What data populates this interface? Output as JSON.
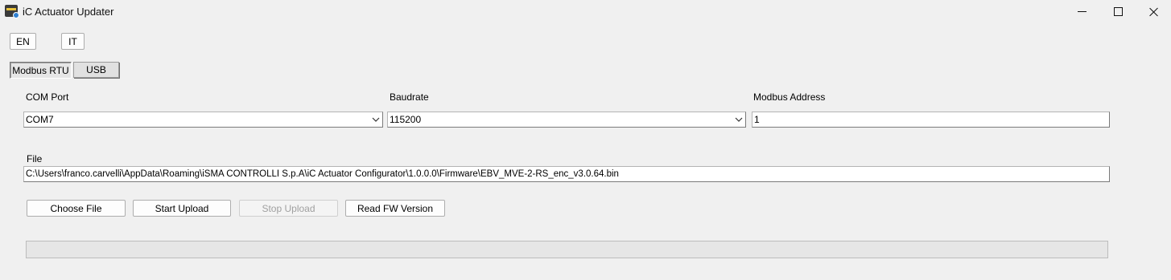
{
  "window": {
    "title": "iC Actuator Updater",
    "icon": "actuator-app-icon",
    "controls": [
      "minimize-icon",
      "maximize-icon",
      "close-icon"
    ]
  },
  "language": {
    "en_label": "EN",
    "it_label": "IT"
  },
  "tabs": [
    {
      "label": "Modbus RTU",
      "active": true
    },
    {
      "label": "USB",
      "active": false
    }
  ],
  "connection": {
    "com_port_label": "COM Port",
    "com_port_value": "COM7",
    "baudrate_label": "Baudrate",
    "baudrate_value": "115200",
    "modbus_address_label": "Modbus Address",
    "modbus_address_value": "1"
  },
  "file": {
    "label": "File",
    "path": "C:\\Users\\franco.carvelli\\AppData\\Roaming\\iSMA CONTROLLI S.p.A\\iC Actuator Configurator\\1.0.0.0\\Firmware\\EBV_MVE-2-RS_enc_v3.0.64.bin"
  },
  "actions": {
    "choose_file": "Choose File",
    "start_upload": "Start Upload",
    "stop_upload": "Stop Upload",
    "read_fw_version": "Read FW Version"
  },
  "progress": {
    "value": 0
  },
  "colors": {
    "background": "#f0f0f0",
    "progress_fill": "#06b025",
    "disabled_text": "#a0a0a0"
  }
}
